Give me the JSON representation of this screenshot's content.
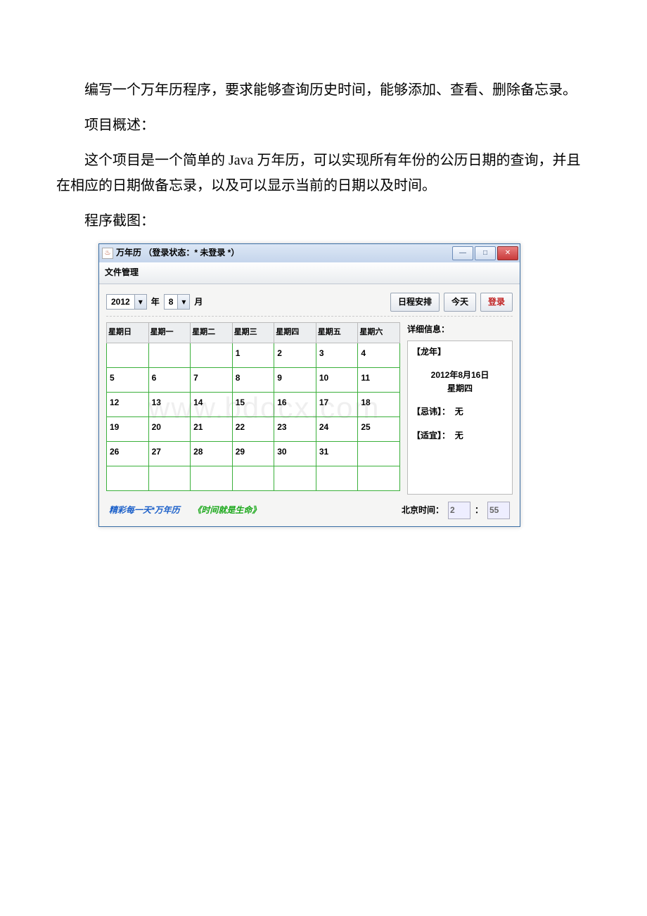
{
  "doc": {
    "para1": "编写一个万年历程序，要求能够查询历史时间，能够添加、查看、删除备忘录。",
    "para2": "项目概述：",
    "para3": "这个项目是一个简单的 Java 万年历，可以实现所有年份的公历日期的查询，并且在相应的日期做备忘录，以及可以显示当前的日期以及时间。",
    "para4": "程序截图："
  },
  "win": {
    "title": "万年历    （登录状态：* 未登录 *）",
    "menu": "文件管理",
    "btns": {
      "min": "—",
      "max": "□",
      "close": "✕"
    }
  },
  "toolbar": {
    "year": "2012",
    "year_label": "年",
    "month": "8",
    "month_label": "月",
    "schedule": "日程安排",
    "today": "今天",
    "login": "登录"
  },
  "calendar": {
    "headers": [
      "星期日",
      "星期一",
      "星期二",
      "星期三",
      "星期四",
      "星期五",
      "星期六"
    ],
    "rows": [
      [
        "",
        "",
        "",
        "1",
        "2",
        "3",
        "4"
      ],
      [
        "5",
        "6",
        "7",
        "8",
        "9",
        "10",
        "11"
      ],
      [
        "12",
        "13",
        "14",
        "15",
        "16",
        "17",
        "18"
      ],
      [
        "19",
        "20",
        "21",
        "22",
        "23",
        "24",
        "25"
      ],
      [
        "26",
        "27",
        "28",
        "29",
        "30",
        "31",
        ""
      ],
      [
        "",
        "",
        "",
        "",
        "",
        "",
        ""
      ]
    ]
  },
  "info": {
    "title": "详细信息：",
    "zodiac": "【龙年】",
    "date_line1": "2012年8月16日",
    "date_line2": "星期四",
    "avoid_label": "【忌讳】：",
    "avoid_value": "无",
    "suit_label": "【适宜】：",
    "suit_value": "无"
  },
  "status": {
    "left": "精彩每一天*万年历",
    "mid": "《时间就是生命》",
    "clock_label": "北京时间：",
    "hour": "2",
    "sep": "：",
    "minute": "55"
  }
}
